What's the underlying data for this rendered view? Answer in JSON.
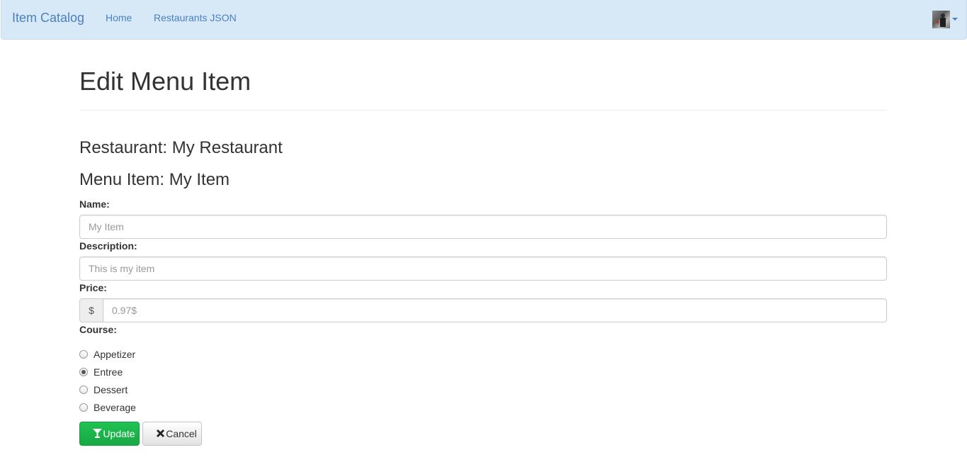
{
  "navbar": {
    "brand": "Item Catalog",
    "links": [
      "Home",
      "Restaurants JSON"
    ],
    "user_avatar_icon": "user-avatar",
    "dropdown_icon": "caret-down-icon"
  },
  "page": {
    "title": "Edit Menu Item",
    "restaurant_heading": "Restaurant: My Restaurant",
    "item_heading": "Menu Item: My Item"
  },
  "form": {
    "name_label": "Name:",
    "name_placeholder": "My Item",
    "description_label": "Description:",
    "description_placeholder": "This is my item",
    "price_label": "Price:",
    "price_addon": "$",
    "price_placeholder": "0.97$",
    "course_label": "Course:",
    "course_options": [
      "Appetizer",
      "Entree",
      "Dessert",
      "Beverage"
    ],
    "course_selected": "Entree"
  },
  "buttons": {
    "update_label": "Update",
    "update_icon": "glass-icon",
    "update_color": "#1cb94e",
    "cancel_label": "Cancel",
    "cancel_icon": "remove-icon"
  },
  "colors": {
    "navbar_bg": "#d7e9f7",
    "link": "#4a7fc0"
  }
}
